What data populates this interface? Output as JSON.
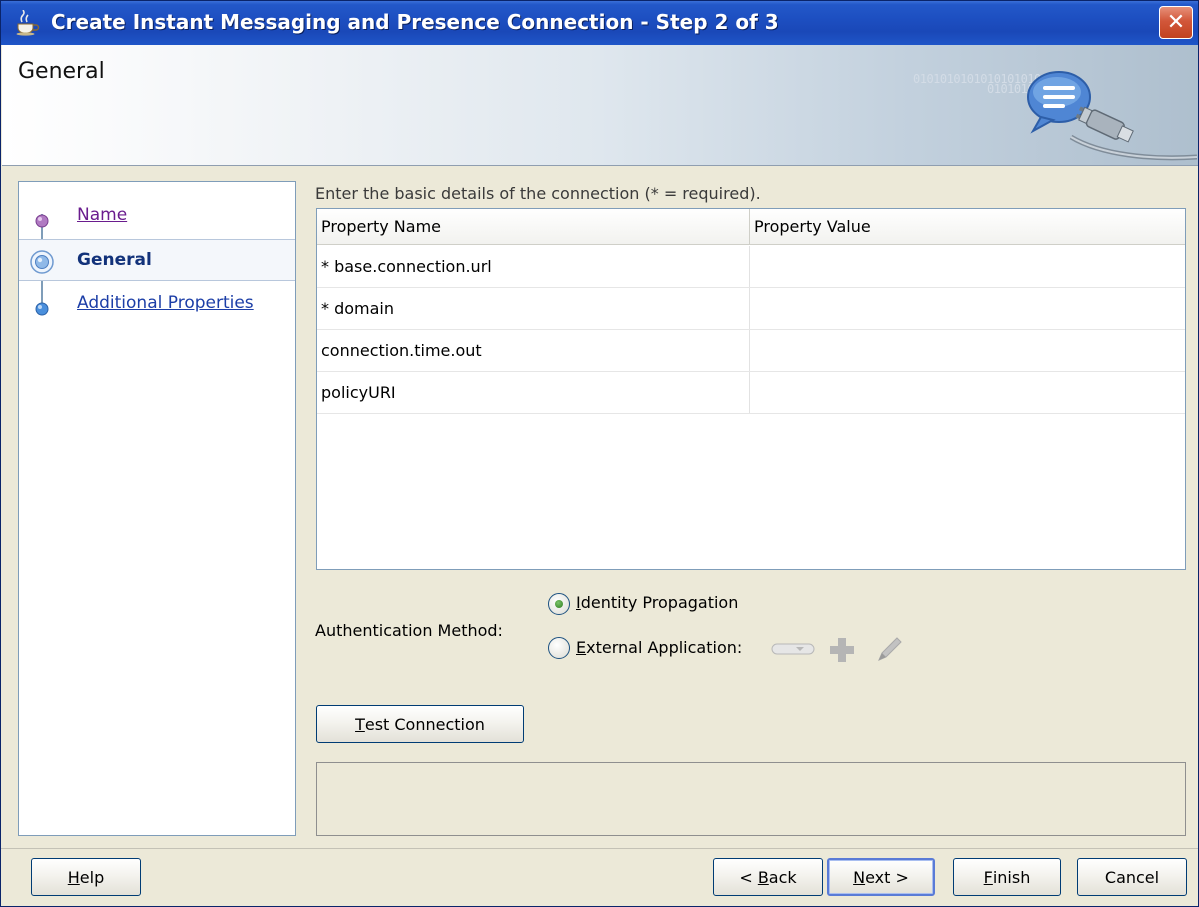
{
  "window": {
    "title": "Create Instant Messaging and Presence Connection - Step 2 of 3",
    "close_glyph": "✕"
  },
  "header": {
    "title": "General",
    "binary_line1": "010101010101010101010101",
    "binary_line2": "0101010101010"
  },
  "nav": {
    "items": [
      {
        "label": "Name",
        "state": "visited"
      },
      {
        "label": "General",
        "state": "current"
      },
      {
        "label": "Additional Properties",
        "state": "link"
      }
    ]
  },
  "main": {
    "instructions": "Enter the basic details of the connection (* = required).",
    "table": {
      "columns": [
        "Property Name",
        "Property Value"
      ],
      "rows": [
        {
          "name": "* base.connection.url",
          "value": ""
        },
        {
          "name": "* domain",
          "value": ""
        },
        {
          "name": "connection.time.out",
          "value": ""
        },
        {
          "name": "policyURI",
          "value": ""
        }
      ]
    },
    "auth": {
      "label": "Authentication Method:",
      "option1": {
        "mnemonic": "I",
        "rest": "dentity Propagation",
        "selected": true
      },
      "option2": {
        "mnemonic": "E",
        "rest": "xternal Application:",
        "selected": false
      }
    },
    "test_button": {
      "mnemonic": "T",
      "rest": "est Connection"
    }
  },
  "footer": {
    "help": {
      "mnemonic": "H",
      "rest": "elp"
    },
    "back": {
      "pre": "< ",
      "mnemonic": "B",
      "rest": "ack"
    },
    "next": {
      "mnemonic": "N",
      "rest": "ext >"
    },
    "finish": {
      "mnemonic": "F",
      "rest": "inish"
    },
    "cancel": {
      "label": "Cancel"
    }
  },
  "colors": {
    "titlebar": "#1d4fc1",
    "link": "#1c3ea7",
    "visited_link": "#6a1c8e",
    "current_nav": "#12327a",
    "close_button": "#c2421f"
  }
}
